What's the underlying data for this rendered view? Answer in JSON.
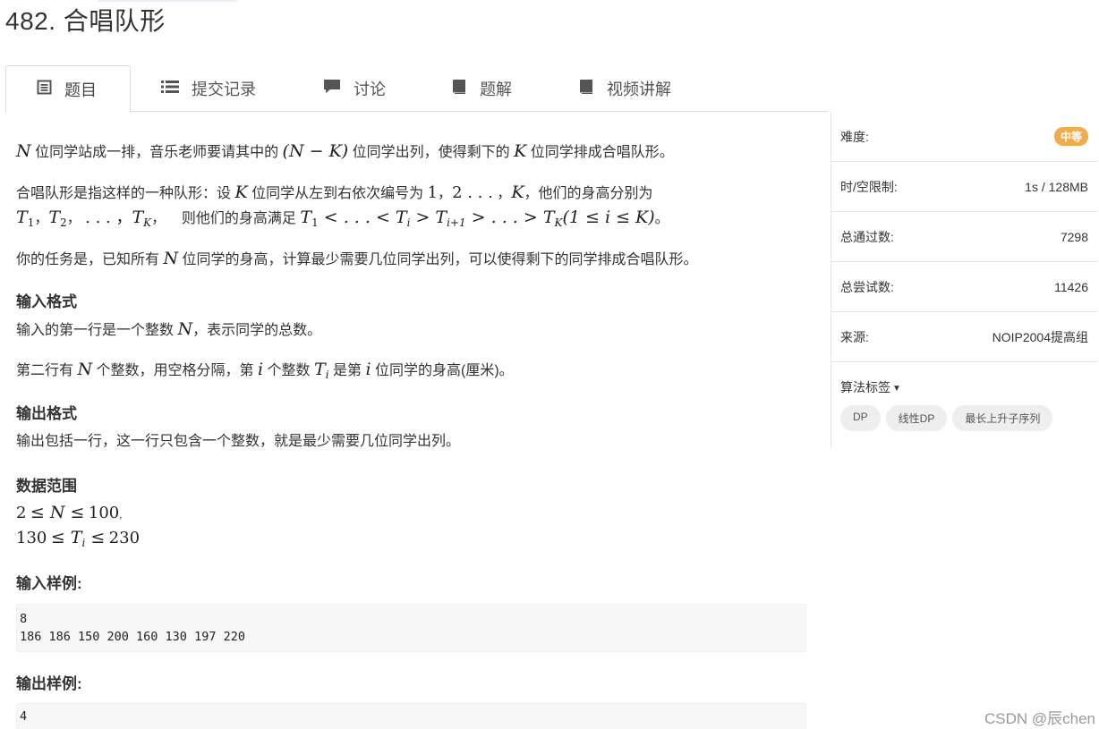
{
  "problem": {
    "title": "482. 合唱队形"
  },
  "tabs": [
    {
      "label": "题目",
      "icon": "document-icon"
    },
    {
      "label": "提交记录",
      "icon": "list-icon"
    },
    {
      "label": "讨论",
      "icon": "comment-icon"
    },
    {
      "label": "题解",
      "icon": "book-icon"
    },
    {
      "label": "视频讲解",
      "icon": "book-icon"
    }
  ],
  "statement": {
    "p1_a": "位同学站成一排，音乐老师要请其中的",
    "p1_b": "位同学出列，使得剩下的",
    "p1_c": "位同学排成合唱队形。",
    "p2_a": "合唱队形是指这样的一种队形：设",
    "p2_b": "位同学从左到右依次编号为",
    "p2_c": "，他们的身高分别为",
    "p2_d": "则他们的身高满足",
    "p3_a": "你的任务是，已知所有",
    "p3_b": "位同学的身高，计算最少需要几位同学出列，可以使得剩下的同学排成合唱队形。"
  },
  "input_format": {
    "heading": "输入格式",
    "line1_a": "输入的第一行是一个整数",
    "line1_b": "，表示同学的总数。",
    "line2_a": "第二行有",
    "line2_b": "个整数，用空格分隔，第",
    "line2_c": "个整数",
    "line2_d": "是第",
    "line2_e": "位同学的身高(厘米)。"
  },
  "output_format": {
    "heading": "输出格式",
    "line1": "输出包括一行，这一行只包含一个整数，就是最少需要几位同学出列。"
  },
  "data_range": {
    "heading": "数据范围",
    "c1_lo": "2",
    "c1_hi": "100",
    "c2_lo": "130",
    "c2_hi": "230"
  },
  "sample_input": {
    "heading": "输入样例:",
    "content": "8\n186 186 150 200 160 130 197 220"
  },
  "sample_output": {
    "heading": "输出样例:",
    "content": "4"
  },
  "sidebar": {
    "difficulty_label": "难度:",
    "difficulty_value": "中等",
    "limit_label": "时/空限制:",
    "limit_value": "1s / 128MB",
    "passed_label": "总通过数:",
    "passed_value": "7298",
    "tried_label": "总尝试数:",
    "tried_value": "11426",
    "source_label": "来源:",
    "source_value": "NOIP2004提高组",
    "tags_title": "算法标签",
    "tags": [
      "DP",
      "线性DP",
      "最长上升子序列"
    ]
  },
  "watermark": "CSDN @辰chen",
  "colors": {
    "badge": "#f0ad4e",
    "tag_bg": "#eeeeee",
    "code_bg": "#f7f7f7"
  }
}
